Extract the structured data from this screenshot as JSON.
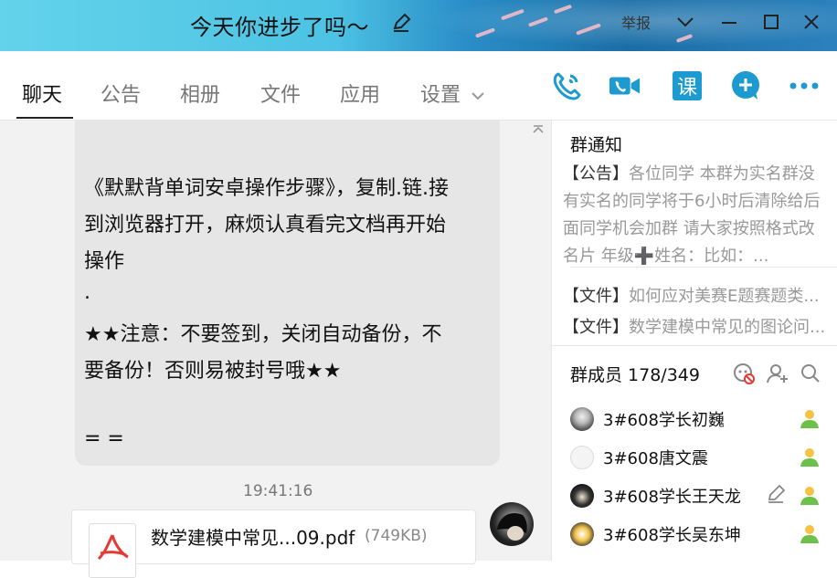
{
  "window": {
    "title": "今天你进步了吗～",
    "report_label": "举报"
  },
  "tabs": [
    {
      "label": "聊天",
      "active": true
    },
    {
      "label": "公告"
    },
    {
      "label": "相册"
    },
    {
      "label": "文件"
    },
    {
      "label": "应用"
    },
    {
      "label": "设置"
    }
  ],
  "toolbar": {
    "icons": [
      "phone-icon",
      "video-call-icon",
      "lesson-icon",
      "add-icon",
      "more-icon"
    ],
    "lesson_label": "课"
  },
  "chat": {
    "message_lines": [
      "《默默背单词安卓操作步骤》，复制.链.接",
      "到浏览器打开，麻烦认真看完文档再开始",
      "操作",
      ".",
      "★★注意：不要签到，关闭自动备份，不",
      "要备份！否则易被封号哦★★",
      "",
      "= ="
    ],
    "timestamp": "19:41:16",
    "file": {
      "name": "数学建模中常见...09.pdf",
      "size": "(749KB)"
    }
  },
  "sidebar": {
    "notice_title": "群通知",
    "notice_tag": "【公告】",
    "notice_text": "各位同学 本群为实名群没有实名的同学将于6小时后清除给后面同学机会加群 请大家按照格式改名片 年级➕姓名：比如：...",
    "files": [
      {
        "tag": "【文件】",
        "name": "如何应对美赛E题赛题类..."
      },
      {
        "tag": "【文件】",
        "name": "数学建模中常见的图论问..."
      }
    ],
    "members_title": "群成员 178/349",
    "members": [
      {
        "name": "3#608学长初巍"
      },
      {
        "name": "3#608唐文震"
      },
      {
        "name": "3#608学长王天龙"
      },
      {
        "name": "3#608学长吴东坤"
      }
    ],
    "colors": {
      "accent": "#1d9bd1",
      "admin_green": "#6dc04a"
    }
  }
}
